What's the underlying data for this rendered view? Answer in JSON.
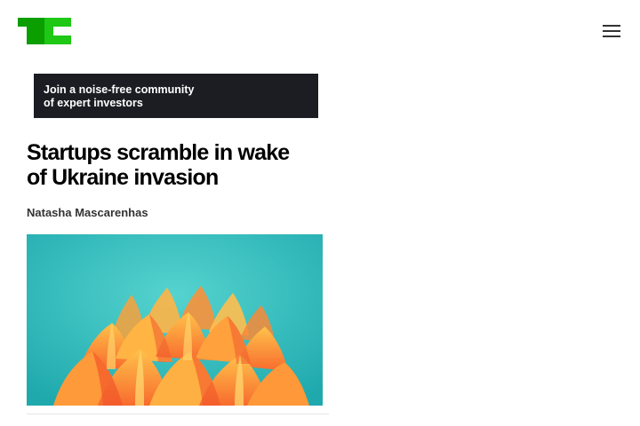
{
  "header": {
    "logo_icon": "techcrunch-logo-icon",
    "menu_icon": "hamburger-menu-icon"
  },
  "ad": {
    "line1": "Join a noise-free community",
    "line2": "of expert investors"
  },
  "article": {
    "headline_line1": "Startups scramble in wake",
    "headline_line2": "of Ukraine invasion",
    "author": "Natasha Mascarenhas",
    "image_icon": "orange-paper-waves-image"
  },
  "colors": {
    "brand_green": "#0a9e01",
    "brand_light_green": "#1ec814",
    "ad_background": "#1b1d23",
    "image_teal": "#2bbcbf",
    "image_orange": "#f9963a"
  }
}
